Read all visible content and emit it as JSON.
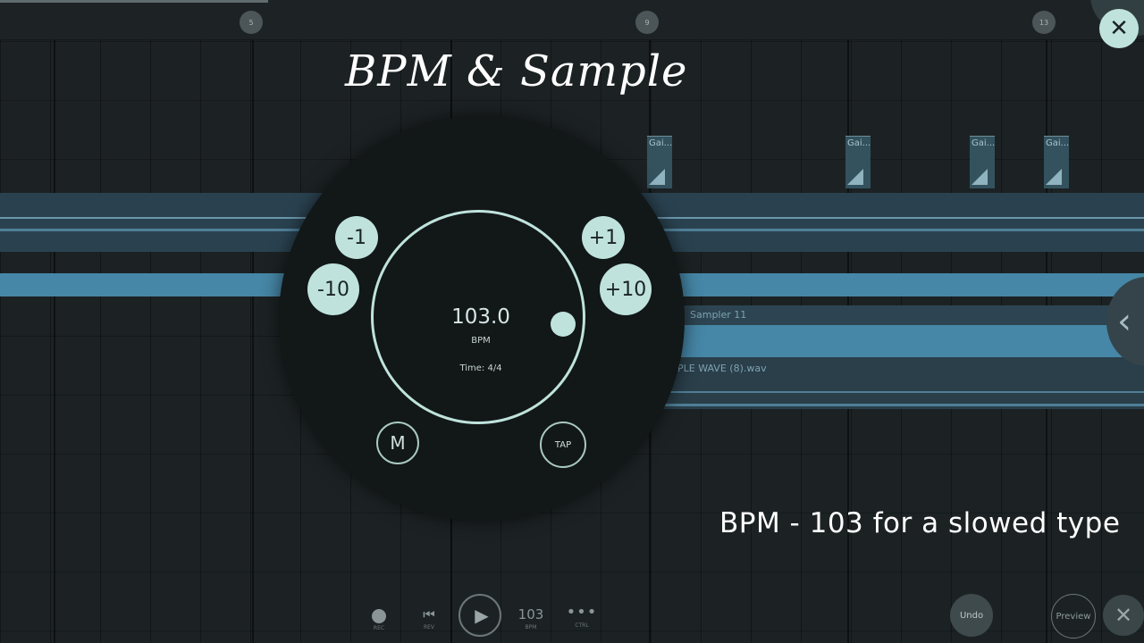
{
  "overlay": {
    "title": "BPM & Sample",
    "caption": "BPM - 103 for a slowed type"
  },
  "ruler": {
    "markers": [
      "5",
      "9",
      "13"
    ]
  },
  "clips": {
    "gain_label": "Gai...",
    "sampler_label": "Sampler 11",
    "wave_file": "PLE WAVE (8).wav"
  },
  "dial": {
    "bpm_value": "103.0",
    "bpm_unit": "BPM",
    "time_signature": "Time: 4/4",
    "minus_one": "-1",
    "minus_ten": "-10",
    "plus_one": "+1",
    "plus_ten": "+10",
    "metronome": "M",
    "tap": "TAP"
  },
  "toolbar": {
    "rec_label": "REC",
    "rev_label": "REV",
    "bpm_value": "103",
    "bpm_label": "BPM",
    "ctrl_label": "CTRL",
    "undo": "Undo",
    "preview": "Preview"
  },
  "icons": {
    "close": "close-icon",
    "back": "chevron-left-icon",
    "play": "play-icon"
  }
}
